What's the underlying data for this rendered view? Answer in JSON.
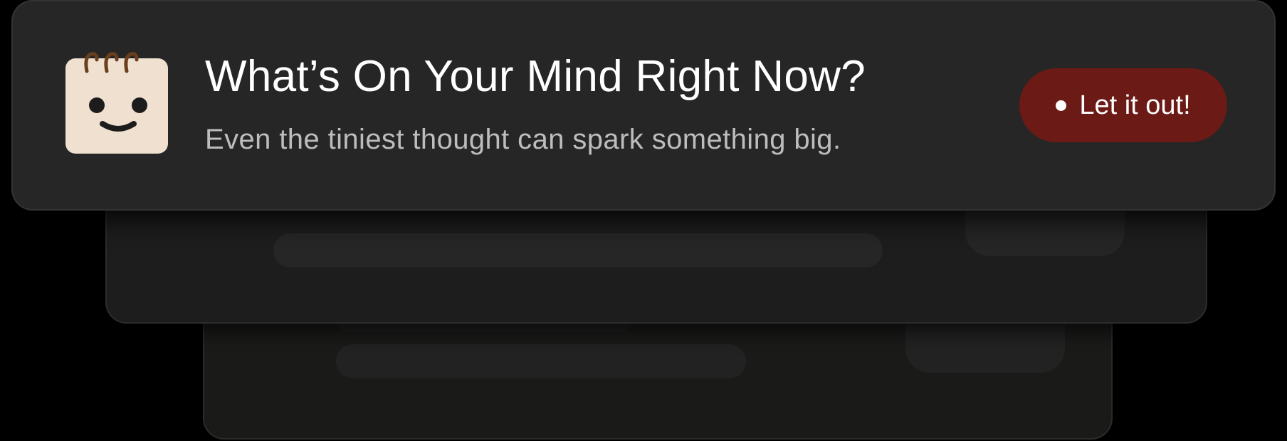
{
  "prompt_card": {
    "title": "What’s On Your Mind Right Now?",
    "subtitle": "Even the tiniest thought can spark something big.",
    "cta": {
      "label": "Let it out!"
    },
    "icon": "smiling-notepad-icon"
  },
  "colors": {
    "card_front": "#262626",
    "card_middle": "#1d1d1d",
    "card_back": "#1a1a19",
    "cta_background": "#6b1a16",
    "icon_paper": "#efe0cf",
    "icon_rings": "#6a3f1d",
    "title_text": "#ffffff",
    "subtitle_text": "#bdbdbd"
  }
}
